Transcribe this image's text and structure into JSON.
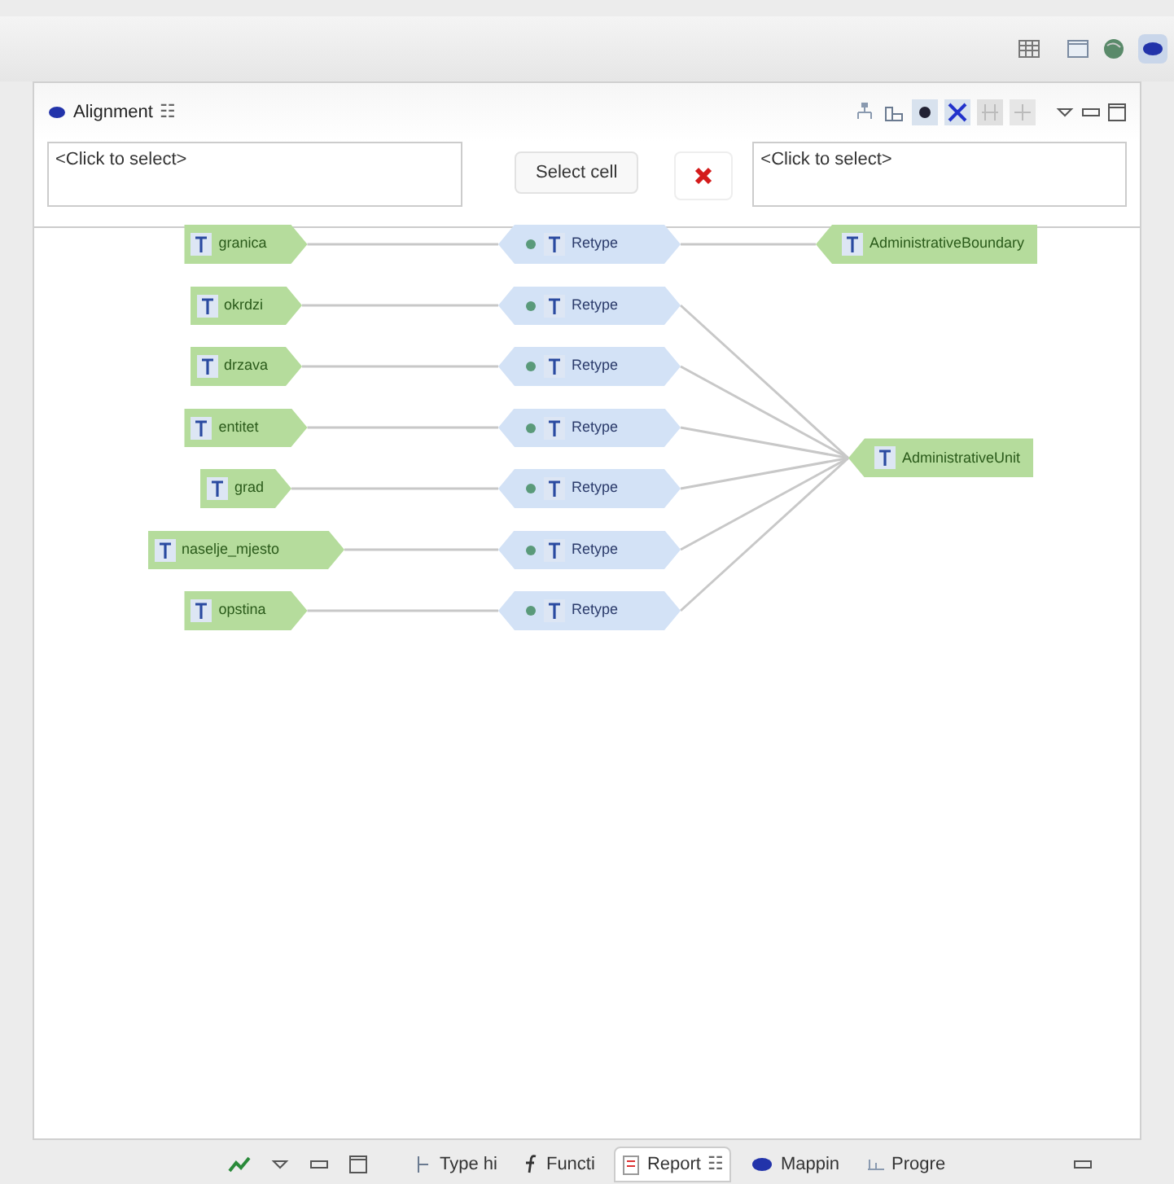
{
  "panel": {
    "title": "Alignment",
    "close_glyph": "☷"
  },
  "selectors": {
    "source": {
      "placeholder": "<Click to select>"
    },
    "button": "Select cell",
    "target": {
      "placeholder": "<Click to select>"
    }
  },
  "graph": {
    "targets": [
      {
        "label": "AdministrativeBoundary",
        "mappings": [
          {
            "source": "granica",
            "function": "Retype"
          }
        ]
      },
      {
        "label": "AdministrativeUnit",
        "mappings": [
          {
            "source": "okrdzi",
            "function": "Retype"
          },
          {
            "source": "drzava",
            "function": "Retype"
          },
          {
            "source": "entitet",
            "function": "Retype"
          },
          {
            "source": "grad",
            "function": "Retype"
          },
          {
            "source": "naselje_mjesto",
            "function": "Retype"
          },
          {
            "source": "opstina",
            "function": "Retype"
          }
        ]
      }
    ]
  },
  "bottom_tabs": [
    {
      "label": "Type hi",
      "selected": false
    },
    {
      "label": "Functi",
      "selected": false
    },
    {
      "label": "Report",
      "selected": true
    },
    {
      "label": "Mappin",
      "selected": false
    },
    {
      "label": "Progre",
      "selected": false
    }
  ],
  "close_glyph": "☷"
}
